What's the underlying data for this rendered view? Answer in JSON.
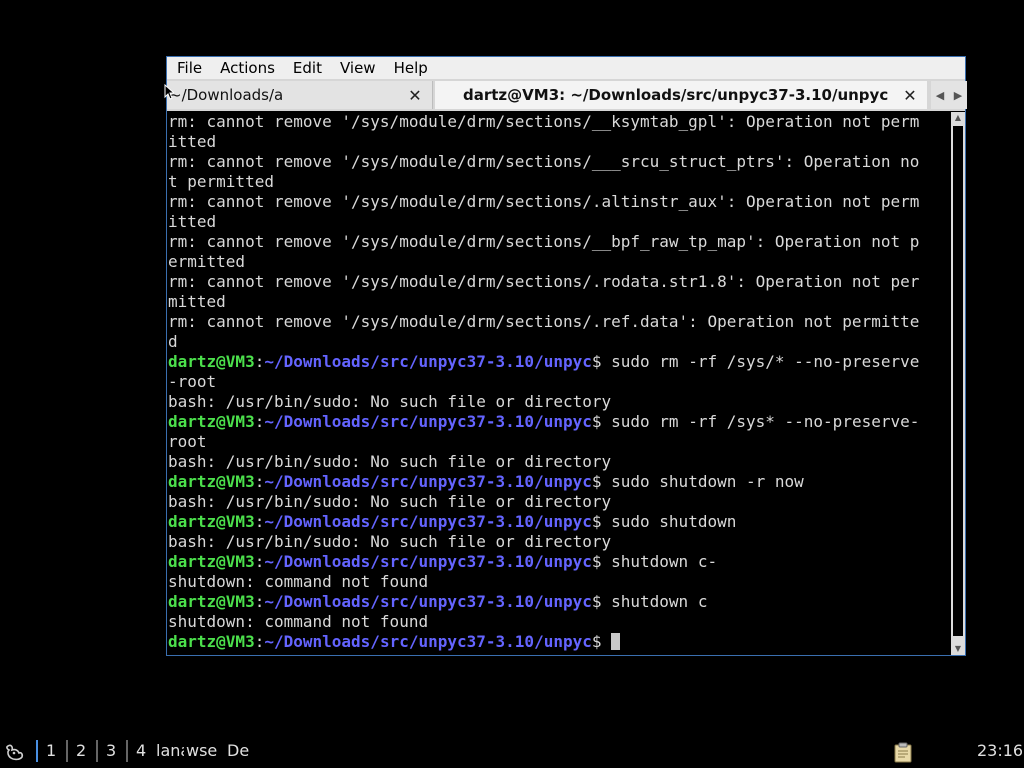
{
  "menubar": {
    "items": [
      "File",
      "Actions",
      "Edit",
      "View",
      "Help"
    ]
  },
  "tabs": [
    {
      "label": "~/Downloads/a",
      "close": "✕",
      "active": false
    },
    {
      "label": "dartz@VM3: ~/Downloads/src/unpyc37-3.10/unpyc",
      "close": "✕",
      "active": true
    }
  ],
  "tab_scroll": {
    "left": "◀",
    "right": "▶"
  },
  "prompt": {
    "user_host": "dartz@VM3",
    "colon": ":",
    "path": "~/Downloads/src/unpyc37-3.10/unpyc",
    "dollar": "$ "
  },
  "terminal": {
    "lines": [
      {
        "type": "out",
        "text": "rm: cannot remove '/sys/module/drm/sections/__ksymtab_gpl': Operation not perm"
      },
      {
        "type": "out",
        "text": "itted"
      },
      {
        "type": "out",
        "text": "rm: cannot remove '/sys/module/drm/sections/___srcu_struct_ptrs': Operation no"
      },
      {
        "type": "out",
        "text": "t permitted"
      },
      {
        "type": "out",
        "text": "rm: cannot remove '/sys/module/drm/sections/.altinstr_aux': Operation not perm"
      },
      {
        "type": "out",
        "text": "itted"
      },
      {
        "type": "out",
        "text": "rm: cannot remove '/sys/module/drm/sections/__bpf_raw_tp_map': Operation not p"
      },
      {
        "type": "out",
        "text": "ermitted"
      },
      {
        "type": "out",
        "text": "rm: cannot remove '/sys/module/drm/sections/.rodata.str1.8': Operation not per"
      },
      {
        "type": "out",
        "text": "mitted"
      },
      {
        "type": "out",
        "text": "rm: cannot remove '/sys/module/drm/sections/.ref.data': Operation not permitte"
      },
      {
        "type": "out",
        "text": "d"
      },
      {
        "type": "prompt",
        "text": "sudo rm -rf /sys/* --no-preserve"
      },
      {
        "type": "out",
        "text": "-root"
      },
      {
        "type": "out",
        "text": "bash: /usr/bin/sudo: No such file or directory"
      },
      {
        "type": "prompt",
        "text": "sudo rm -rf /sys* --no-preserve-"
      },
      {
        "type": "out",
        "text": "root"
      },
      {
        "type": "out",
        "text": "bash: /usr/bin/sudo: No such file or directory"
      },
      {
        "type": "prompt",
        "text": "sudo shutdown -r now"
      },
      {
        "type": "out",
        "text": "bash: /usr/bin/sudo: No such file or directory"
      },
      {
        "type": "prompt",
        "text": "sudo shutdown"
      },
      {
        "type": "out",
        "text": "bash: /usr/bin/sudo: No such file or directory"
      },
      {
        "type": "prompt",
        "text": "shutdown c-"
      },
      {
        "type": "out",
        "text": "shutdown: command not found"
      },
      {
        "type": "prompt",
        "text": "shutdown c"
      },
      {
        "type": "out",
        "text": "shutdown: command not found"
      },
      {
        "type": "prompt_cursor",
        "text": ""
      }
    ]
  },
  "taskbar": {
    "start_icon": "menu-logo-icon",
    "workspaces": [
      "1",
      "2",
      "3",
      "4"
    ],
    "tasks": [
      "lana",
      "wse",
      "De"
    ],
    "tray_icon": "clipboard-icon",
    "clock": "23:16"
  },
  "colors": {
    "prompt_user": "#4ce04c",
    "prompt_path": "#6464ff",
    "terminal_text": "#d9d9d9",
    "terminal_bg": "#000000",
    "window_border": "#3a6fb0",
    "workspace_active": "#4a90e2"
  }
}
